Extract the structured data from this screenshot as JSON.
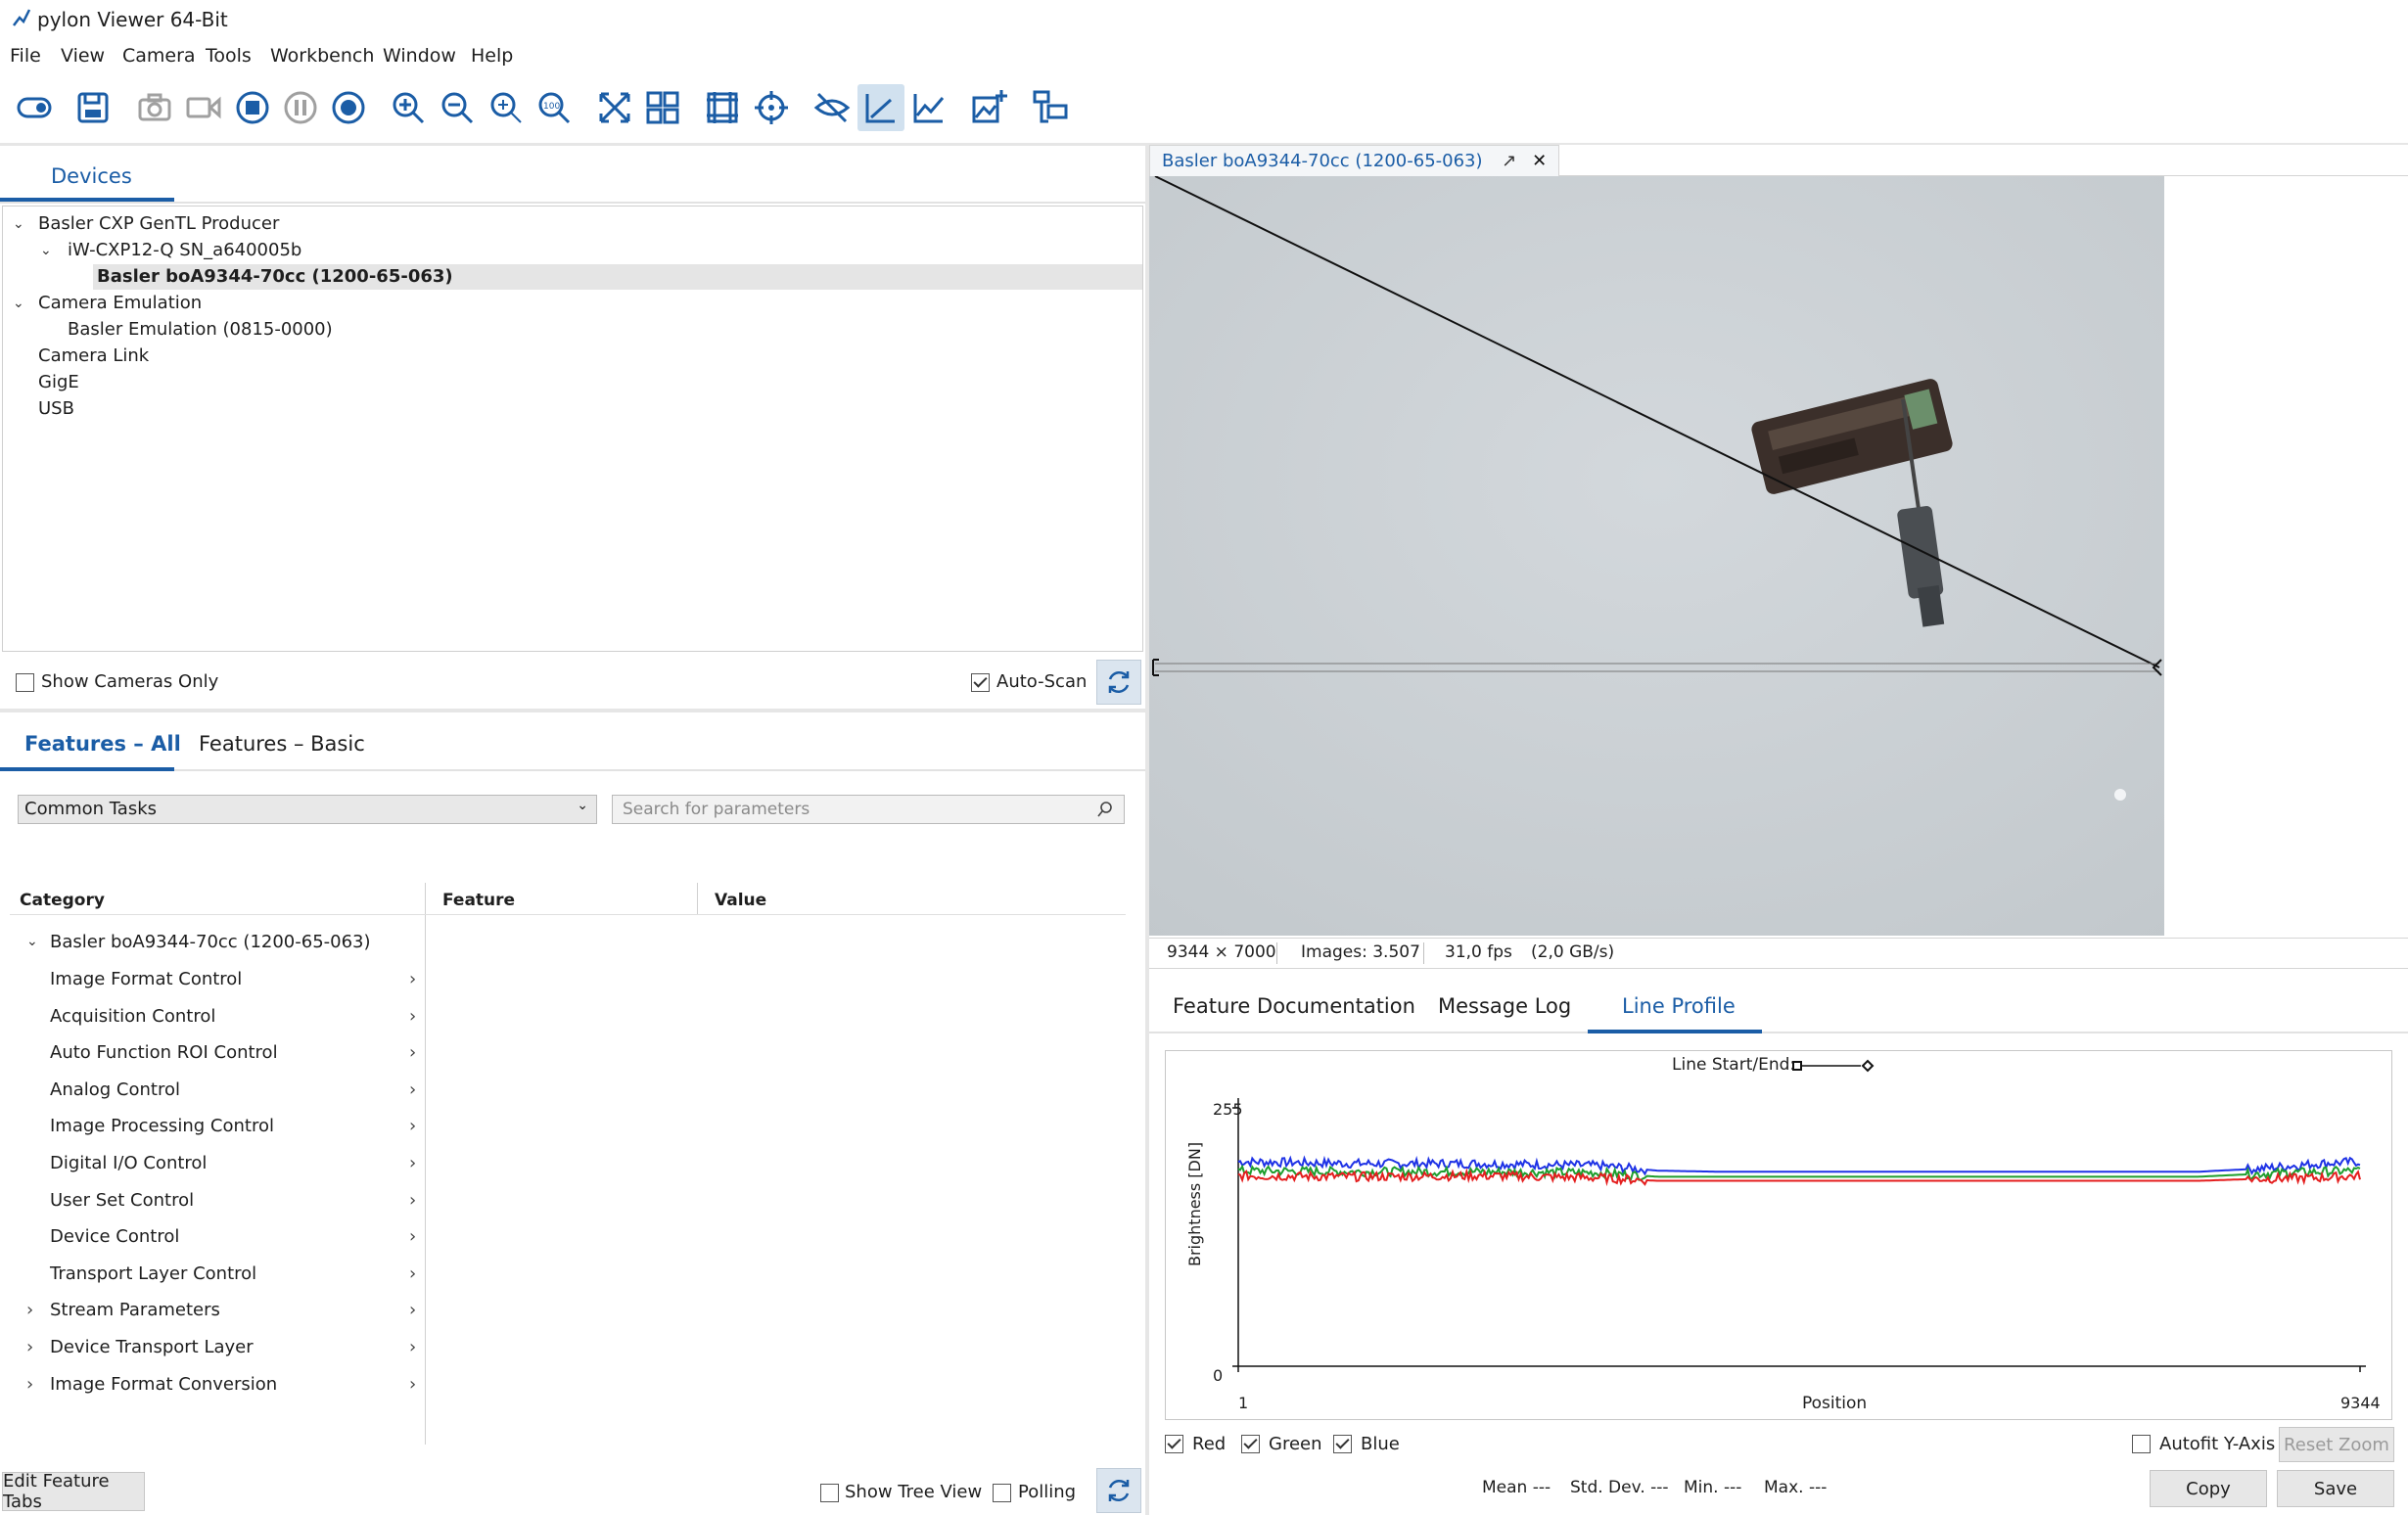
{
  "window": {
    "title": "pylon Viewer 64-Bit"
  },
  "menu": [
    "File",
    "View",
    "Camera",
    "Tools",
    "Workbench",
    "Window",
    "Help"
  ],
  "toolbar": {
    "icons": [
      "toggle-icon",
      "save-icon",
      "camera-snapshot-icon",
      "video-icon",
      "stop-icon",
      "pause-icon",
      "record-icon",
      "zoom-in-icon",
      "zoom-out-icon",
      "zoom-fit-icon",
      "zoom-100-icon",
      "fullscreen-icon",
      "grid-layout-icon",
      "pixel-grid-icon",
      "crosshair-icon",
      "hide-overlay-icon",
      "line-profile-icon",
      "histogram-icon",
      "add-image-icon",
      "workbench-icon"
    ]
  },
  "devices": {
    "tab": "Devices",
    "tree": [
      {
        "label": "Basler CXP GenTL Producer",
        "level": 0,
        "expanded": true
      },
      {
        "label": "iW-CXP12-Q SN_a640005b",
        "level": 1,
        "expanded": true
      },
      {
        "label": "Basler boA9344-70cc (1200-65-063)",
        "level": 2,
        "selected": true
      },
      {
        "label": "Camera Emulation",
        "level": 0,
        "expanded": true
      },
      {
        "label": "Basler Emulation (0815-0000)",
        "level": 1
      },
      {
        "label": "Camera Link",
        "level": 0
      },
      {
        "label": "GigE",
        "level": 0
      },
      {
        "label": "USB",
        "level": 0
      }
    ],
    "show_cameras_only": {
      "label": "Show Cameras Only",
      "checked": false
    },
    "auto_scan": {
      "label": "Auto-Scan",
      "checked": true
    }
  },
  "features": {
    "tabs": [
      "Features – All",
      "Features – Basic"
    ],
    "dropdown_value": "Common Tasks",
    "search_placeholder": "Search for parameters",
    "columns": [
      "Category",
      "Feature",
      "Value"
    ],
    "root": "Basler boA9344-70cc (1200-65-063)",
    "categories": [
      {
        "label": "Image Format Control",
        "expander": false
      },
      {
        "label": "Acquisition Control",
        "expander": false
      },
      {
        "label": "Auto Function ROI Control",
        "expander": false
      },
      {
        "label": "Analog Control",
        "expander": false
      },
      {
        "label": "Image Processing Control",
        "expander": false
      },
      {
        "label": "Digital I/O Control",
        "expander": false
      },
      {
        "label": "User Set Control",
        "expander": false
      },
      {
        "label": "Device Control",
        "expander": false
      },
      {
        "label": "Transport Layer Control",
        "expander": false
      },
      {
        "label": "Stream Parameters",
        "expander": true
      },
      {
        "label": "Device Transport Layer",
        "expander": true
      },
      {
        "label": "Image Format Conversion",
        "expander": true
      }
    ],
    "edit_tabs_button": "Edit Feature Tabs",
    "show_tree_view": {
      "label": "Show Tree View",
      "checked": false
    },
    "polling": {
      "label": "Polling",
      "checked": false
    }
  },
  "image_view": {
    "tab_title": "Basler boA9344-70cc (1200-65-063)",
    "status": {
      "resolution": "9344 × 7000",
      "images": "Images: 3.507",
      "fps": "31,0 fps",
      "bandwidth": "(2,0 GB/s)"
    }
  },
  "bottom_tabs": [
    "Feature Documentation",
    "Message Log",
    "Line Profile"
  ],
  "line_profile": {
    "header": "Line Start/End:",
    "checkboxes": [
      {
        "label": "Red",
        "checked": true
      },
      {
        "label": "Green",
        "checked": true
      },
      {
        "label": "Blue",
        "checked": true
      }
    ],
    "autofit": {
      "label": "Autofit Y-Axis",
      "checked": false
    },
    "reset_zoom": "Reset Zoom",
    "stats": {
      "mean": "Mean ---",
      "std": "Std. Dev. ---",
      "min": "Min. ---",
      "max": "Max. ---"
    },
    "copy_button": "Copy",
    "save_button": "Save"
  },
  "chart_data": {
    "type": "line",
    "xlabel": "Position",
    "ylabel": "Brightness [DN]",
    "xlim": [
      1,
      9344
    ],
    "ylim": [
      0,
      255
    ],
    "x_ticks": [
      "1",
      "9344"
    ],
    "y_ticks": [
      "255",
      "0"
    ],
    "x": [
      1,
      1000,
      2000,
      3000,
      3500,
      4000,
      5000,
      6000,
      7000,
      8000,
      8500,
      9000,
      9344
    ],
    "series": [
      {
        "name": "Red",
        "color": "#e41e1e",
        "values": [
          188,
          187,
          188,
          186,
          183,
          183,
          183,
          183,
          183,
          183,
          185,
          186,
          188
        ]
      },
      {
        "name": "Green",
        "color": "#1e9e2e",
        "values": [
          193,
          192,
          192,
          191,
          187,
          187,
          187,
          187,
          187,
          187,
          190,
          192,
          193
        ]
      },
      {
        "name": "Blue",
        "color": "#1e32e6",
        "values": [
          202,
          200,
          200,
          198,
          193,
          192,
          192,
          192,
          192,
          192,
          195,
          200,
          202
        ]
      }
    ],
    "grid": false
  },
  "colors": {
    "accent": "#1b5da6",
    "tab_active": "#1b5da6"
  }
}
